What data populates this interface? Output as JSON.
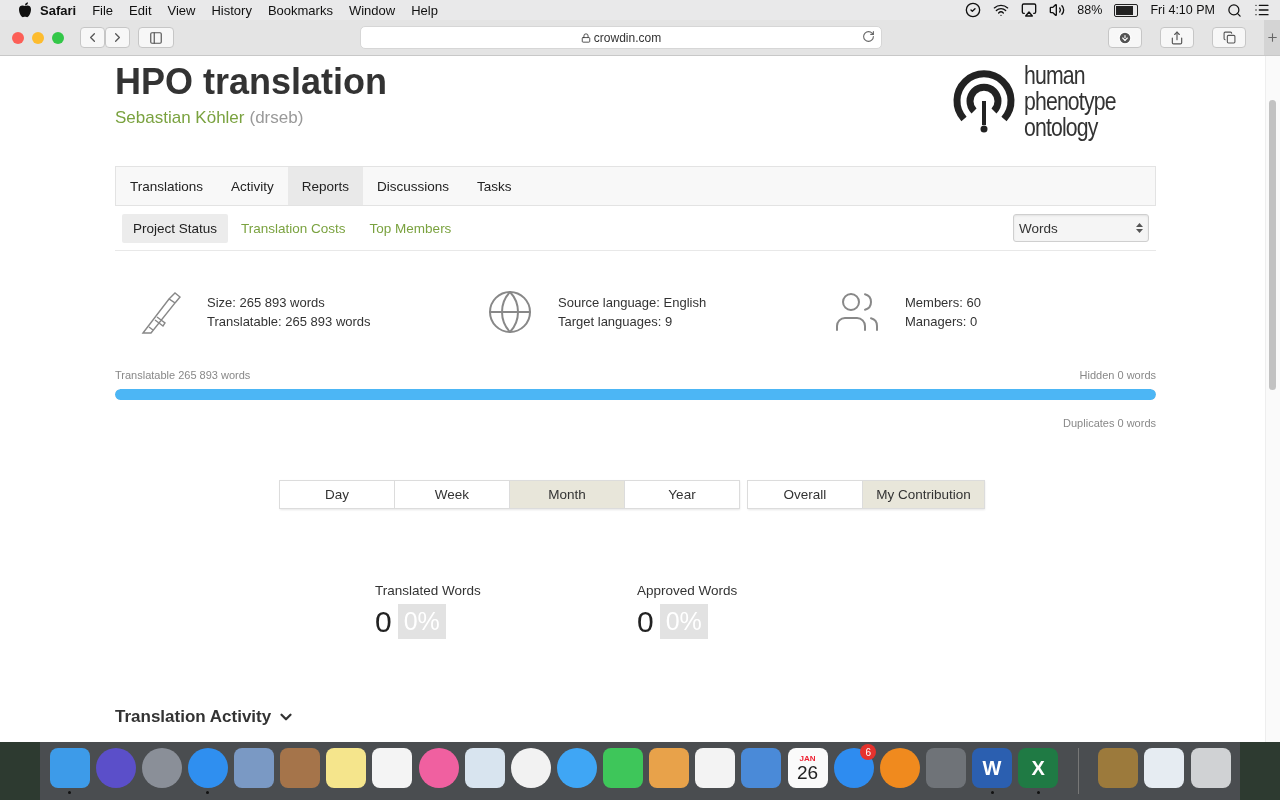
{
  "menu_bar": {
    "app": "Safari",
    "menus": [
      "File",
      "Edit",
      "View",
      "History",
      "Bookmarks",
      "Window",
      "Help"
    ],
    "battery": "88%",
    "clock": "Fri 4:10 PM"
  },
  "browser": {
    "address": "crowdin.com"
  },
  "project": {
    "title": "HPO translation",
    "owner": "Sebastian Köhler",
    "handle": "(drseb)",
    "logo_lines": [
      "human",
      "phenotype",
      "ontology"
    ]
  },
  "tabs": [
    {
      "label": "Translations",
      "selected": false
    },
    {
      "label": "Activity",
      "selected": false
    },
    {
      "label": "Reports",
      "selected": true
    },
    {
      "label": "Discussions",
      "selected": false
    },
    {
      "label": "Tasks",
      "selected": false
    }
  ],
  "subtabs": [
    {
      "label": "Project Status",
      "selected": true
    },
    {
      "label": "Translation Costs",
      "selected": false
    },
    {
      "label": "Top Members",
      "selected": false
    }
  ],
  "unit_select": {
    "value": "Words"
  },
  "stats": [
    {
      "kind": "caliper",
      "lines": [
        "Size: 265 893 words",
        "Translatable: 265 893 words"
      ]
    },
    {
      "kind": "globe",
      "lines": [
        "Source language: English",
        "Target languages: 9"
      ]
    },
    {
      "kind": "members",
      "lines": [
        "Members: 60",
        "Managers: 0"
      ]
    }
  ],
  "progress": {
    "left_label": "Translatable 265 893 words",
    "right_label": "Hidden 0 words",
    "level": 1,
    "footer": "Duplicates 0 words"
  },
  "periods": [
    {
      "label": "Day",
      "selected": false
    },
    {
      "label": "Week",
      "selected": false
    },
    {
      "label": "Month",
      "selected": true
    },
    {
      "label": "Year",
      "selected": false
    }
  ],
  "scopes": [
    {
      "label": "Overall",
      "selected": false
    },
    {
      "label": "My Contribution",
      "selected": true
    }
  ],
  "metrics": [
    {
      "label": "Translated Words",
      "value": "0",
      "percent": "0%"
    },
    {
      "label": "Approved Words",
      "value": "0",
      "percent": "0%"
    }
  ],
  "section": {
    "title": "Translation Activity"
  },
  "dock": [
    {
      "kind": "square",
      "color": "#3d9be9",
      "running": true
    },
    {
      "kind": "round",
      "color": "#5b4fc9",
      "running": false
    },
    {
      "kind": "round",
      "color": "#8a8f98",
      "running": false
    },
    {
      "kind": "round",
      "color": "#2f8ff0",
      "running": true
    },
    {
      "kind": "square",
      "color": "#7a99c4",
      "running": false
    },
    {
      "kind": "square",
      "color": "#a5744a",
      "running": false
    },
    {
      "kind": "square",
      "color": "#f5e58c",
      "running": false
    },
    {
      "kind": "square",
      "color": "#f4f4f4",
      "running": false
    },
    {
      "kind": "round",
      "color": "#f060a0",
      "running": false
    },
    {
      "kind": "square",
      "color": "#d8e4ef",
      "running": false
    },
    {
      "kind": "round",
      "color": "#f2f2f2",
      "running": false
    },
    {
      "kind": "round",
      "color": "#3fa6f5",
      "running": false
    },
    {
      "kind": "square",
      "color": "#3ec65a",
      "running": false
    },
    {
      "kind": "square",
      "color": "#e8a24a",
      "running": false
    },
    {
      "kind": "square",
      "color": "#f3f3f3",
      "running": false
    },
    {
      "kind": "square",
      "color": "#4a8ad8",
      "running": false
    },
    {
      "kind": "square",
      "color": "#fafafa",
      "running": false,
      "month": "JAN",
      "day": "26"
    },
    {
      "kind": "round",
      "color": "#2e8cf0",
      "running": false,
      "badge": "6"
    },
    {
      "kind": "round",
      "color": "#f08a1e",
      "running": false
    },
    {
      "kind": "square",
      "color": "#6f7378",
      "running": false
    },
    {
      "kind": "square",
      "color": "#2b5fb0",
      "running": true,
      "letter": "W"
    },
    {
      "kind": "square",
      "color": "#1f7a44",
      "running": true,
      "letter": "X"
    },
    {
      "kind": "separator"
    },
    {
      "kind": "square",
      "color": "#9c7a3c",
      "running": false
    },
    {
      "kind": "square",
      "color": "#e6ecf2",
      "running": false
    },
    {
      "kind": "square",
      "color": "#d0d2d4",
      "running": false
    }
  ]
}
